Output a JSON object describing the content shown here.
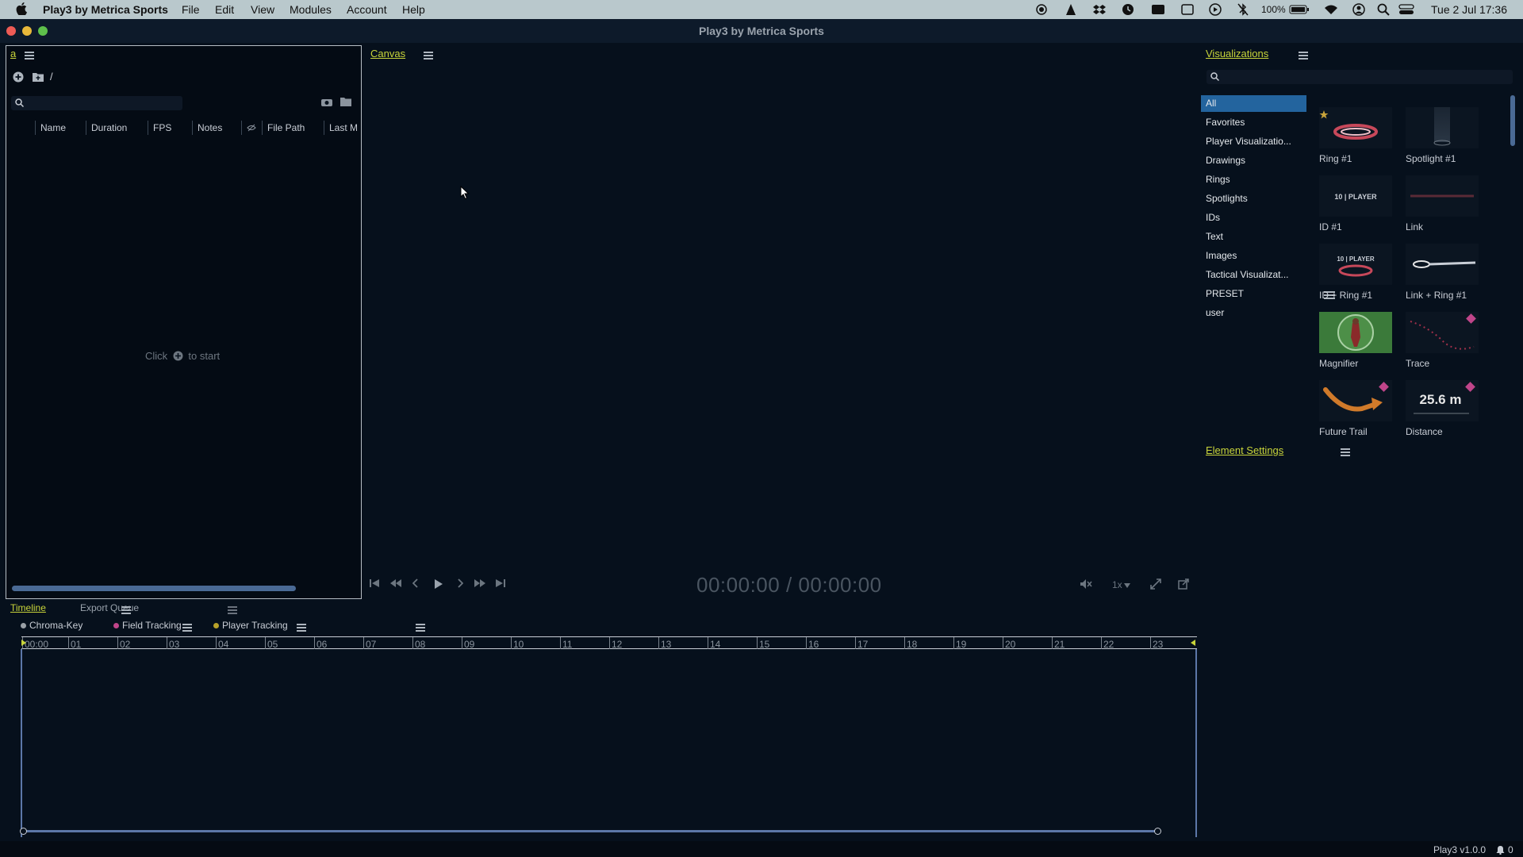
{
  "menubar": {
    "app_name": "Play3 by Metrica Sports",
    "items": [
      "File",
      "Edit",
      "View",
      "Modules",
      "Account",
      "Help"
    ],
    "battery": "100%",
    "clock": "Tue 2 Jul  17:36"
  },
  "window": {
    "title": "Play3 by Metrica Sports"
  },
  "browser": {
    "tab_label": "a",
    "path": "/",
    "columns": [
      "Name",
      "Duration",
      "FPS",
      "Notes",
      "File Path",
      "Last M"
    ],
    "empty_hint_before": "Click",
    "empty_hint_after": "to start"
  },
  "canvas": {
    "title": "Canvas",
    "current_time": "00:00:00",
    "separator": "/",
    "total_time": "00:00:00",
    "speed": "1x"
  },
  "visualizations": {
    "title": "Visualizations",
    "categories": [
      "All",
      "Favorites",
      "Player Visualizatio...",
      "Drawings",
      "Rings",
      "Spotlights",
      "IDs",
      "Text",
      "Images",
      "Tactical Visualizat...",
      "PRESET",
      "user"
    ],
    "selected_category": "All",
    "items": [
      "Ring #1",
      "Spotlight #1",
      "ID #1",
      "Link",
      "ID + Ring #1",
      "Link + Ring #1",
      "Magnifier",
      "Trace",
      "Future Trail",
      "Distance"
    ],
    "thumb_texts": {
      "id_player": "10 | PLAYER",
      "distance": "25.6 m"
    }
  },
  "element_settings": {
    "title": "Element Settings"
  },
  "timeline": {
    "tabs": [
      "Timeline",
      "Export Queue"
    ],
    "tracks": [
      {
        "name": "Chroma-Key",
        "color": "#9aa0a6"
      },
      {
        "name": "Field Tracking",
        "color": "#c0458a"
      },
      {
        "name": "Player Tracking",
        "color": "#b8a22a"
      }
    ],
    "ruler": [
      "00:00",
      "01",
      "02",
      "03",
      "04",
      "05",
      "06",
      "07",
      "08",
      "09",
      "10",
      "11",
      "12",
      "13",
      "14",
      "15",
      "16",
      "17",
      "18",
      "19",
      "20",
      "21",
      "22",
      "23"
    ]
  },
  "footer": {
    "version": "Play3 v1.0.0",
    "notifications": "0"
  },
  "colors": {
    "accent": "#c8d43a",
    "selection": "#23649e",
    "background": "#06101c"
  }
}
